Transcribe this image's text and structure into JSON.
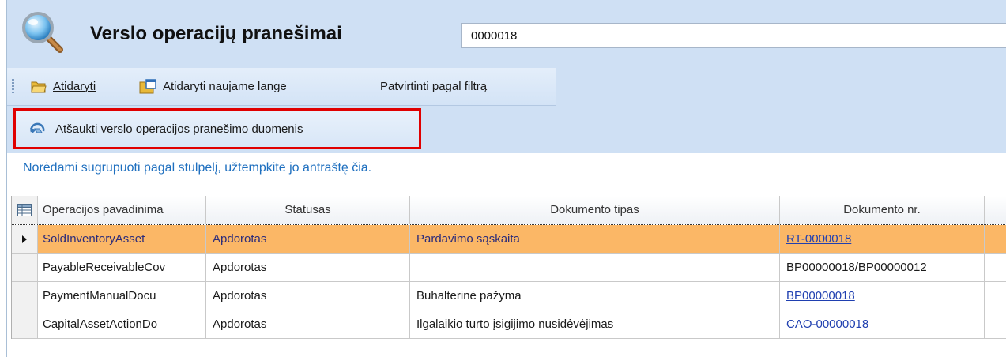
{
  "header": {
    "title": "Verslo operacijų pranešimai",
    "search_value": "0000018"
  },
  "toolbar": {
    "open_label": "Atidaryti",
    "open_new_window_label": "Atidaryti naujame lange",
    "confirm_by_filter_label": "Patvirtinti pagal filtrą",
    "cancel_data_label": "Atšaukti verslo operacijos pranešimo duomenis"
  },
  "grid": {
    "group_hint": "Norėdami sugrupuoti pagal stulpelį, užtempkite jo antraštę čia.",
    "columns": [
      "Operacijos pavadinima",
      "Statusas",
      "Dokumento tipas",
      "Dokumento nr."
    ],
    "rows": [
      {
        "operation": "SoldInventoryAsset",
        "status": "Apdorotas",
        "doc_type": "Pardavimo sąskaita",
        "doc_no": "RT-0000018",
        "selected": true,
        "doc_link": true
      },
      {
        "operation": "PayableReceivableCov",
        "status": "Apdorotas",
        "doc_type": "",
        "doc_no": "BP00000018/BP00000012",
        "selected": false,
        "doc_link": false
      },
      {
        "operation": "PaymentManualDocu",
        "status": "Apdorotas",
        "doc_type": "Buhalterinė pažyma",
        "doc_no": "BP00000018",
        "selected": false,
        "doc_link": true
      },
      {
        "operation": "CapitalAssetActionDo",
        "status": "Apdorotas",
        "doc_type": "Ilgalaikio turto įsigijimo nusidėvėjimas",
        "doc_no": "CAO-00000018",
        "selected": false,
        "doc_link": true
      }
    ]
  },
  "colors": {
    "header_bg": "#cfe0f4",
    "selected_row": "#fbb766",
    "highlight_border": "#e00000",
    "link": "#1f3fb0"
  }
}
